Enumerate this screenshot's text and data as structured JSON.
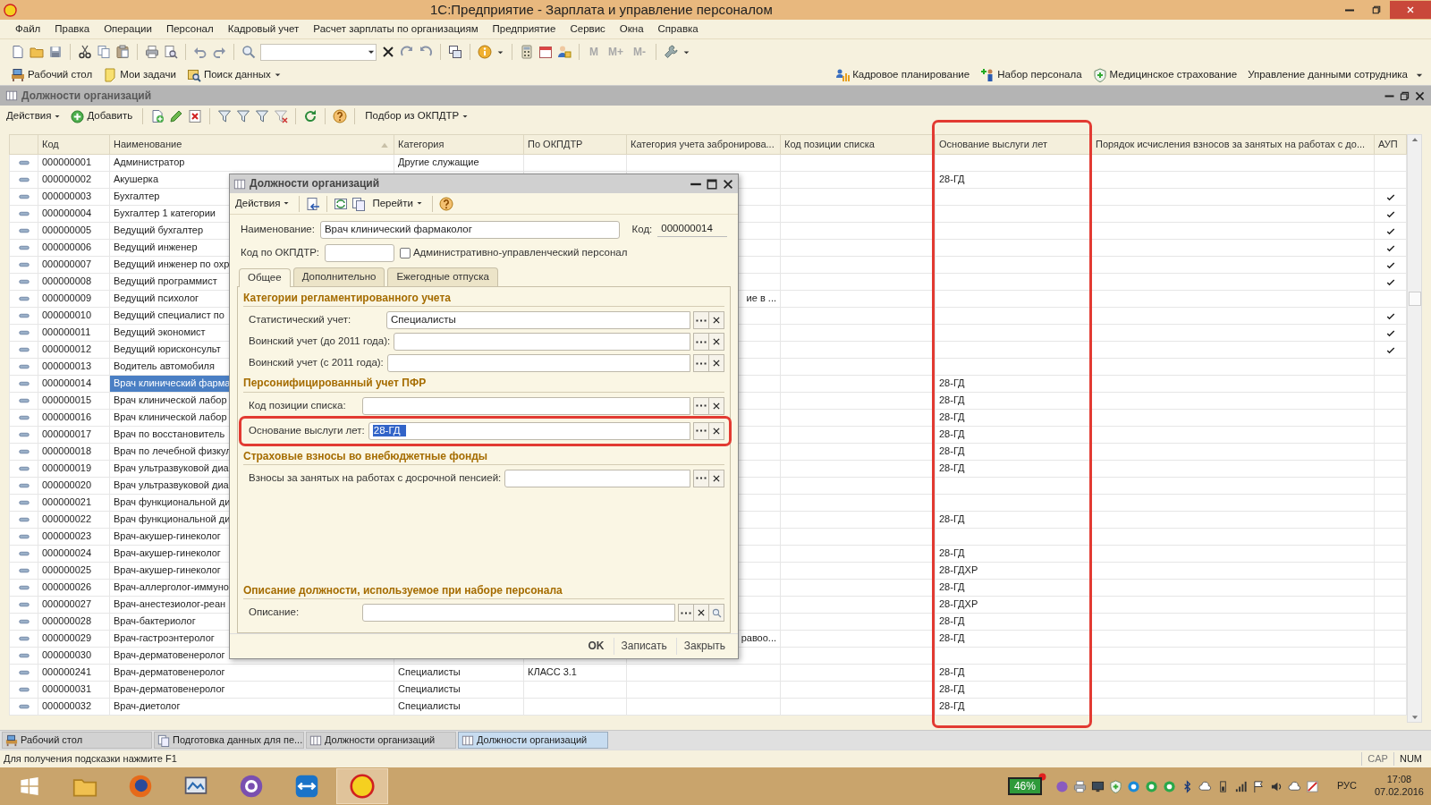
{
  "window": {
    "title": "1С:Предприятие - Зарплата и управление персоналом"
  },
  "menu": [
    "Файл",
    "Правка",
    "Операции",
    "Персонал",
    "Кадровый учет",
    "Расчет зарплаты по организациям",
    "Предприятие",
    "Сервис",
    "Окна",
    "Справка"
  ],
  "toolbar": {
    "memory_buttons": [
      {
        "label": "M",
        "disabled": true
      },
      {
        "label": "M+",
        "disabled": true
      },
      {
        "label": "M-",
        "disabled": true
      }
    ]
  },
  "panel": {
    "left": [
      "Рабочий стол",
      "Мои задачи",
      "Поиск данных"
    ],
    "right": [
      "Кадровое планирование",
      "Набор персонала",
      "Медицинское страхование",
      "Управление данными сотрудника"
    ]
  },
  "list_window": {
    "title": "Должности организаций",
    "toolbar": {
      "actions": "Действия",
      "add": "Добавить",
      "pick": "Подбор из ОКПДТР"
    },
    "table": {
      "columns": [
        {
          "label": "Код",
          "sorted": false,
          "framed": false
        },
        {
          "label": "Наименование",
          "sorted": true,
          "framed": false
        },
        {
          "label": "Категория",
          "sorted": false,
          "framed": false
        },
        {
          "label": "По ОКПДТР",
          "sorted": false,
          "framed": false
        },
        {
          "label": "Категория учета забронирова...",
          "sorted": false,
          "framed": false
        },
        {
          "label": "Код позиции списка",
          "sorted": false,
          "framed": false
        },
        {
          "label": "Основание выслуги лет",
          "sorted": false,
          "framed": true
        },
        {
          "label": "Порядок исчисления взносов за занятых на работах с до...",
          "sorted": false,
          "framed": false
        },
        {
          "label": "АУП",
          "sorted": false,
          "framed": false
        }
      ],
      "rows": [
        {
          "code": "000000001",
          "name": "Администратор",
          "category": "Другие служащие",
          "selected": false,
          "aup_checked": false
        },
        {
          "code": "000000002",
          "name": "Акушерка",
          "seniority": "28-ГД",
          "selected": false,
          "aup_checked": false
        },
        {
          "code": "000000003",
          "name": "Бухгалтер",
          "selected": false,
          "aup_checked": true
        },
        {
          "code": "000000004",
          "name": "Бухгалтер 1 категории",
          "selected": false,
          "aup_checked": true
        },
        {
          "code": "000000005",
          "name": "Ведущий бухгалтер",
          "selected": false,
          "aup_checked": true
        },
        {
          "code": "000000006",
          "name": "Ведущий инженер",
          "selected": false,
          "aup_checked": true
        },
        {
          "code": "000000007",
          "name": "Ведущий инженер по охр",
          "selected": false,
          "aup_checked": true
        },
        {
          "code": "000000008",
          "name": "Ведущий программист",
          "selected": false,
          "aup_checked": true
        },
        {
          "code": "000000009",
          "name": "Ведущий психолог",
          "reserve_category": "ие в ...",
          "selected": false,
          "aup_checked": false
        },
        {
          "code": "000000010",
          "name": "Ведущий специалист по",
          "selected": false,
          "aup_checked": true
        },
        {
          "code": "000000011",
          "name": "Ведущий экономист",
          "selected": false,
          "aup_checked": true
        },
        {
          "code": "000000012",
          "name": "Ведущий юрисконсульт",
          "selected": false,
          "aup_checked": true
        },
        {
          "code": "000000013",
          "name": "Водитель автомобиля",
          "selected": false,
          "aup_checked": false
        },
        {
          "code": "000000014",
          "name": "Врач клинический фарма",
          "seniority": "28-ГД",
          "selected": true,
          "aup_checked": false
        },
        {
          "code": "000000015",
          "name": "Врач клинической лабор",
          "seniority": "28-ГД",
          "selected": false,
          "aup_checked": false
        },
        {
          "code": "000000016",
          "name": "Врач клинической лабор",
          "seniority": "28-ГД",
          "selected": false,
          "aup_checked": false
        },
        {
          "code": "000000017",
          "name": "Врач по восстановитель",
          "seniority": "28-ГД",
          "selected": false,
          "aup_checked": false
        },
        {
          "code": "000000018",
          "name": "Врач по лечебной физкул",
          "seniority": "28-ГД",
          "selected": false,
          "aup_checked": false
        },
        {
          "code": "000000019",
          "name": "Врач ультразвуковой диа",
          "seniority": "28-ГД",
          "selected": false,
          "aup_checked": false
        },
        {
          "code": "000000020",
          "name": "Врач ультразвуковой диа",
          "selected": false,
          "aup_checked": false
        },
        {
          "code": "000000021",
          "name": "Врач функциональной ди",
          "selected": false,
          "aup_checked": false
        },
        {
          "code": "000000022",
          "name": "Врач функциональной ди",
          "seniority": "28-ГД",
          "selected": false,
          "aup_checked": false
        },
        {
          "code": "000000023",
          "name": "Врач-акушер-гинеколог",
          "selected": false,
          "aup_checked": false
        },
        {
          "code": "000000024",
          "name": "Врач-акушер-гинеколог",
          "seniority": "28-ГД",
          "selected": false,
          "aup_checked": false
        },
        {
          "code": "000000025",
          "name": "Врач-акушер-гинеколог",
          "seniority": "28-ГДХР",
          "selected": false,
          "aup_checked": false
        },
        {
          "code": "000000026",
          "name": "Врач-аллерголог-иммуно",
          "seniority": "28-ГД",
          "selected": false,
          "aup_checked": false
        },
        {
          "code": "000000027",
          "name": "Врач-анестезиолог-реан",
          "seniority": "28-ГДХР",
          "selected": false,
          "aup_checked": false
        },
        {
          "code": "000000028",
          "name": "Врач-бактериолог",
          "seniority": "28-ГД",
          "selected": false,
          "aup_checked": false
        },
        {
          "code": "000000029",
          "name": "Врач-гастроэнтеролог",
          "reserve_category": "равоо...",
          "seniority": "28-ГД",
          "selected": false,
          "aup_checked": false
        },
        {
          "code": "000000030",
          "name": "Врач-дерматовенеролог",
          "selected": false,
          "aup_checked": false
        },
        {
          "code": "000000241",
          "name": "Врач-дерматовенеролог",
          "category": "Специалисты",
          "okpdtr": "КЛАСС 3.1",
          "seniority": "28-ГД",
          "selected": false,
          "aup_checked": false
        },
        {
          "code": "000000031",
          "name": "Врач-дерматовенеролог",
          "category": "Специалисты",
          "seniority": "28-ГД",
          "selected": false,
          "aup_checked": false
        },
        {
          "code": "000000032",
          "name": "Врач-диетолог",
          "category": "Специалисты",
          "seniority": "28-ГД",
          "selected": false,
          "aup_checked": false
        }
      ]
    }
  },
  "dialog": {
    "title": "Должности организаций",
    "toolbar": {
      "actions": "Действия",
      "goto": "Перейти"
    },
    "name": {
      "label": "Наименование:",
      "value": "Врач клинический фармаколог"
    },
    "code": {
      "label": "Код:",
      "value": "000000014"
    },
    "okpdtr": {
      "label": "Код по ОКПДТР:"
    },
    "admin_staff": {
      "label": "Административно-управленческий персонал",
      "checked": false
    },
    "tabs": [
      {
        "label": "Общее",
        "selected": true
      },
      {
        "label": "Дополнительно",
        "selected": false
      },
      {
        "label": "Ежегодные отпуска",
        "selected": false
      }
    ],
    "sections": [
      {
        "title": "Категории регламентированного учета",
        "fields": [
          {
            "label": "Статистический учет:",
            "value": "Специалисты"
          },
          {
            "label": "Воинский учет (до 2011 года):"
          },
          {
            "label": "Воинский учет (с 2011 года):"
          }
        ]
      },
      {
        "title": "Персонифицированный учет ПФР",
        "fields": [
          {
            "label": "Код позиции списка:"
          },
          {
            "label": "Основание выслуги лет:",
            "value": "28-ГД",
            "value_selected": true,
            "framed": true
          }
        ]
      },
      {
        "title": "Страховые взносы во внебюджетные фонды",
        "fields": [
          {
            "label": "Взносы за занятых на работах с досрочной пенсией:"
          }
        ]
      },
      {
        "title": "Описание должности, используемое при наборе персонала",
        "fields": [
          {
            "label": "Описание:",
            "search": true
          }
        ]
      }
    ],
    "buttons": [
      {
        "label": "OK",
        "default": true
      },
      {
        "label": "Записать",
        "default": false
      },
      {
        "label": "Закрыть",
        "default": false
      }
    ]
  },
  "window_tabs": [
    {
      "label": "Рабочий стол",
      "selected": false
    },
    {
      "label": "Подготовка данных для пе...",
      "selected": false
    },
    {
      "label": "Должности организаций",
      "selected": false
    },
    {
      "label": "Должности организаций",
      "selected": true
    }
  ],
  "status_bar": {
    "hint": "Для получения подсказки нажмите F1",
    "indicators": [
      "CAP",
      "NUM"
    ]
  },
  "taskbar": {
    "apps": [
      {
        "active": false
      },
      {
        "active": false
      },
      {
        "active": false
      },
      {
        "active": false
      },
      {
        "active": false
      },
      {
        "active": true
      }
    ],
    "battery": "46%",
    "language": "РУС",
    "time": "17:08",
    "date": "07.02.2016"
  }
}
